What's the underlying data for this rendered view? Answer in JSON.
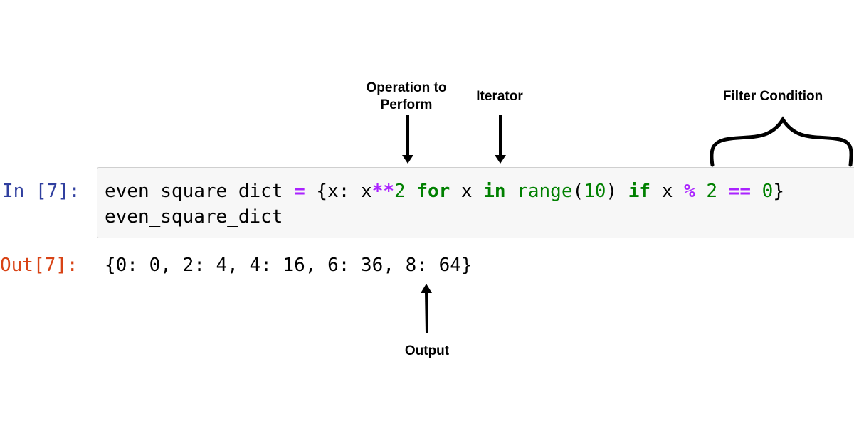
{
  "cell": {
    "in_prompt": "In [7]:",
    "out_prompt": "Out[7]:",
    "code_line1": {
      "var": "even_square_dict ",
      "eq": "=",
      "p1": " {x: x",
      "pow": "**",
      "two": "2",
      "sp1": " ",
      "for": "for",
      "p2": " x ",
      "in": "in",
      "sp2": " ",
      "range": "range",
      "lp": "(",
      "ten": "10",
      "rp": ") ",
      "if": "if",
      "p3": " x ",
      "mod": "%",
      "sp3": " ",
      "two2": "2",
      "sp4": " ",
      "eqeq": "==",
      "sp5": " ",
      "zero": "0",
      "close": "}"
    },
    "code_line2": "even_square_dict",
    "output": "{0: 0, 2: 4, 4: 16, 6: 36, 8: 64}"
  },
  "annotations": {
    "operation": "Operation to\nPerform",
    "operation_line1": "Operation to",
    "operation_line2": "Perform",
    "iterator": "Iterator",
    "filter": "Filter Condition",
    "output": "Output"
  },
  "colors": {
    "in_prompt": "#303f9f",
    "out_prompt": "#d84315",
    "keyword": "#008000",
    "operator": "#aa22ff",
    "cell_bg": "#f7f7f7"
  }
}
